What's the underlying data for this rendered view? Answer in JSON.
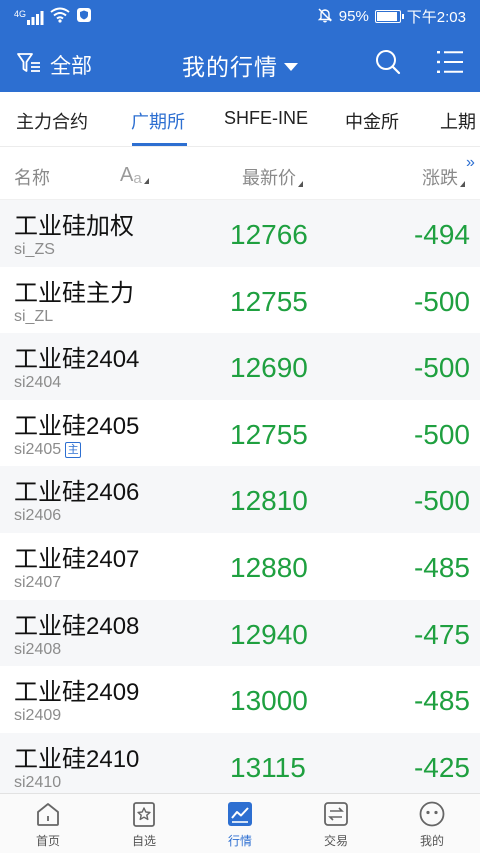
{
  "status_bar": {
    "network": "4G",
    "battery_percent_text": "95%",
    "battery_level": 0.95,
    "time": "下午2:03"
  },
  "app_bar": {
    "filter_label": "全部",
    "title": "我的行情"
  },
  "tabs": [
    {
      "label": "主力合约",
      "active": false
    },
    {
      "label": "广期所",
      "active": true
    },
    {
      "label": "SHFE-INE",
      "active": false
    },
    {
      "label": "中金所",
      "active": false
    },
    {
      "label": "上期",
      "active": false
    }
  ],
  "columns": {
    "name": "名称",
    "aa_big": "A",
    "aa_small": "a",
    "price": "最新价",
    "change": "涨跌"
  },
  "rows": [
    {
      "name": "工业硅加权",
      "code": "si_ZS",
      "price": "12766",
      "change": "-494",
      "main": false
    },
    {
      "name": "工业硅主力",
      "code": "si_ZL",
      "price": "12755",
      "change": "-500",
      "main": false
    },
    {
      "name": "工业硅2404",
      "code": "si2404",
      "price": "12690",
      "change": "-500",
      "main": false
    },
    {
      "name": "工业硅2405",
      "code": "si2405",
      "price": "12755",
      "change": "-500",
      "main": true,
      "badge": "主"
    },
    {
      "name": "工业硅2406",
      "code": "si2406",
      "price": "12810",
      "change": "-500",
      "main": false
    },
    {
      "name": "工业硅2407",
      "code": "si2407",
      "price": "12880",
      "change": "-485",
      "main": false
    },
    {
      "name": "工业硅2408",
      "code": "si2408",
      "price": "12940",
      "change": "-475",
      "main": false
    },
    {
      "name": "工业硅2409",
      "code": "si2409",
      "price": "13000",
      "change": "-485",
      "main": false
    },
    {
      "name": "工业硅2410",
      "code": "si2410",
      "price": "13115",
      "change": "-425",
      "main": false
    }
  ],
  "bottom_nav": [
    {
      "label": "首页",
      "icon": "home-icon",
      "active": false
    },
    {
      "label": "自选",
      "icon": "star-box-icon",
      "active": false
    },
    {
      "label": "行情",
      "icon": "chart-icon",
      "active": true
    },
    {
      "label": "交易",
      "icon": "trade-arrows-icon",
      "active": false
    },
    {
      "label": "我的",
      "icon": "smiley-icon",
      "active": false
    }
  ],
  "colors": {
    "primary": "#2d6fd1",
    "down_green": "#1fa040"
  }
}
